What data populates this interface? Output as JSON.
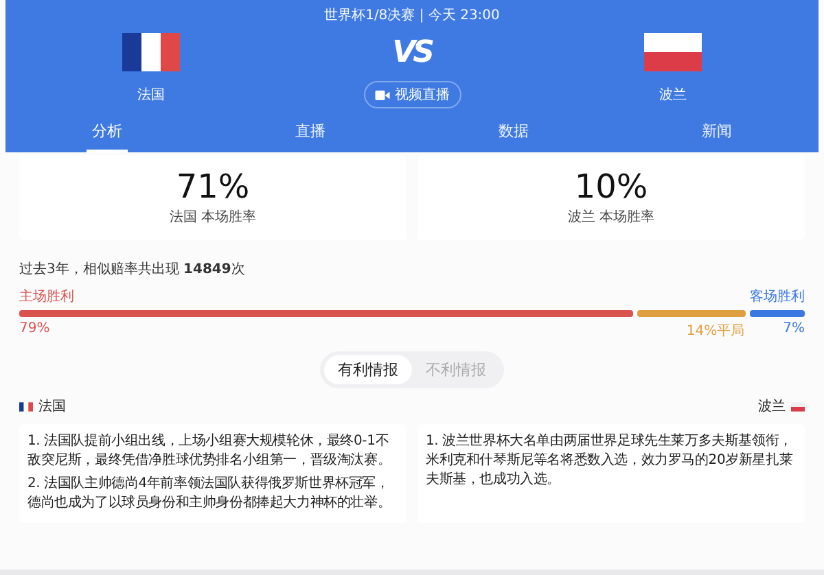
{
  "match_info": "世界杯1/8决赛 | 今天 23:00",
  "home": {
    "name": "法国"
  },
  "away": {
    "name": "波兰"
  },
  "vs": "VS",
  "live_button": "视频直播",
  "tabs": [
    {
      "label": "分析",
      "selected": true
    },
    {
      "label": "直播",
      "selected": false
    },
    {
      "label": "数据",
      "selected": false
    },
    {
      "label": "新闻",
      "selected": false
    }
  ],
  "win_rates": [
    {
      "value": "71%",
      "label": "法国 本场胜率"
    },
    {
      "value": "10%",
      "label": "波兰 本场胜率"
    }
  ],
  "history": "过去3年，相似赔率共出现 **14849**次",
  "outcome_labels": {
    "home": "主场胜利",
    "away": "客场胜利"
  },
  "outcomes": [
    {
      "kind": "home",
      "reading": "79%",
      "color": "#d9534f"
    },
    {
      "kind": "draw",
      "reading": "14%平局",
      "color": "#e0a040"
    },
    {
      "kind": "away",
      "reading": "7%",
      "color": "#3b78e0"
    }
  ],
  "info_tabs": [
    {
      "label": "有利情报",
      "selected": true
    },
    {
      "label": "不利情报",
      "selected": false
    }
  ],
  "info": [
    {
      "team": "法国",
      "items": [
        "1. 法国队提前小组出线，上场小组赛大规模轮休，最终0-1不敌突尼斯，最终凭借净胜球优势排名小组第一，晋级淘汰赛。",
        "2. 法国队主帅德尚4年前率领法国队获得俄罗斯世界杯冠军，德尚也成为了以球员身份和主帅身份都捧起大力神杯的壮举。"
      ]
    },
    {
      "team": "波兰",
      "items": [
        "1. 波兰世界杯大名单由两届世界足球先生莱万多夫斯基领衔，米利克和什琴斯尼等名将悉数入选，效力罗马的20岁新星扎莱夫斯基，也成功入选。"
      ]
    }
  ]
}
